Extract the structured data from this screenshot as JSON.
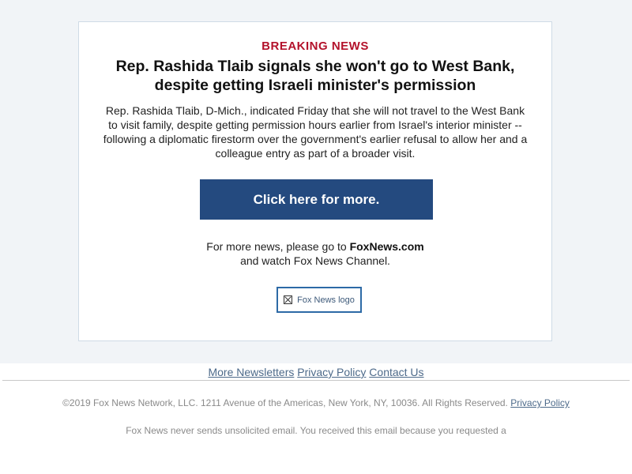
{
  "email": {
    "kicker": "BREAKING NEWS",
    "headline": "Rep. Rashida Tlaib signals she won't go to West Bank, despite getting Israeli minister's permission",
    "summary": "Rep. Rashida Tlaib, D-Mich., indicated Friday that she will not travel to the West Bank to visit family, despite getting permission hours earlier from Israel's interior minister -- following a diplomatic firestorm over the government's earlier refusal to allow her and a colleague entry as part of a broader visit.",
    "cta_label": "Click here for more.",
    "more_prefix": "For more news, please go to ",
    "more_link": "FoxNews.com",
    "more_line2": "and watch Fox News Channel.",
    "logo_alt": "Fox News logo"
  },
  "footer": {
    "links": [
      "More Newsletters",
      "Privacy Policy",
      "Contact Us"
    ],
    "copyright": "©2019 Fox News Network, LLC. 1211 Avenue of the Americas, New York, NY, 10036. All Rights Reserved.",
    "copyright_link": "Privacy Policy",
    "disclaimer": "Fox News never sends unsolicited email. You received this email because you requested a"
  },
  "colors": {
    "accent_red": "#b3122b",
    "button_blue": "#244a7f",
    "link_blue": "#4d6a8a"
  }
}
